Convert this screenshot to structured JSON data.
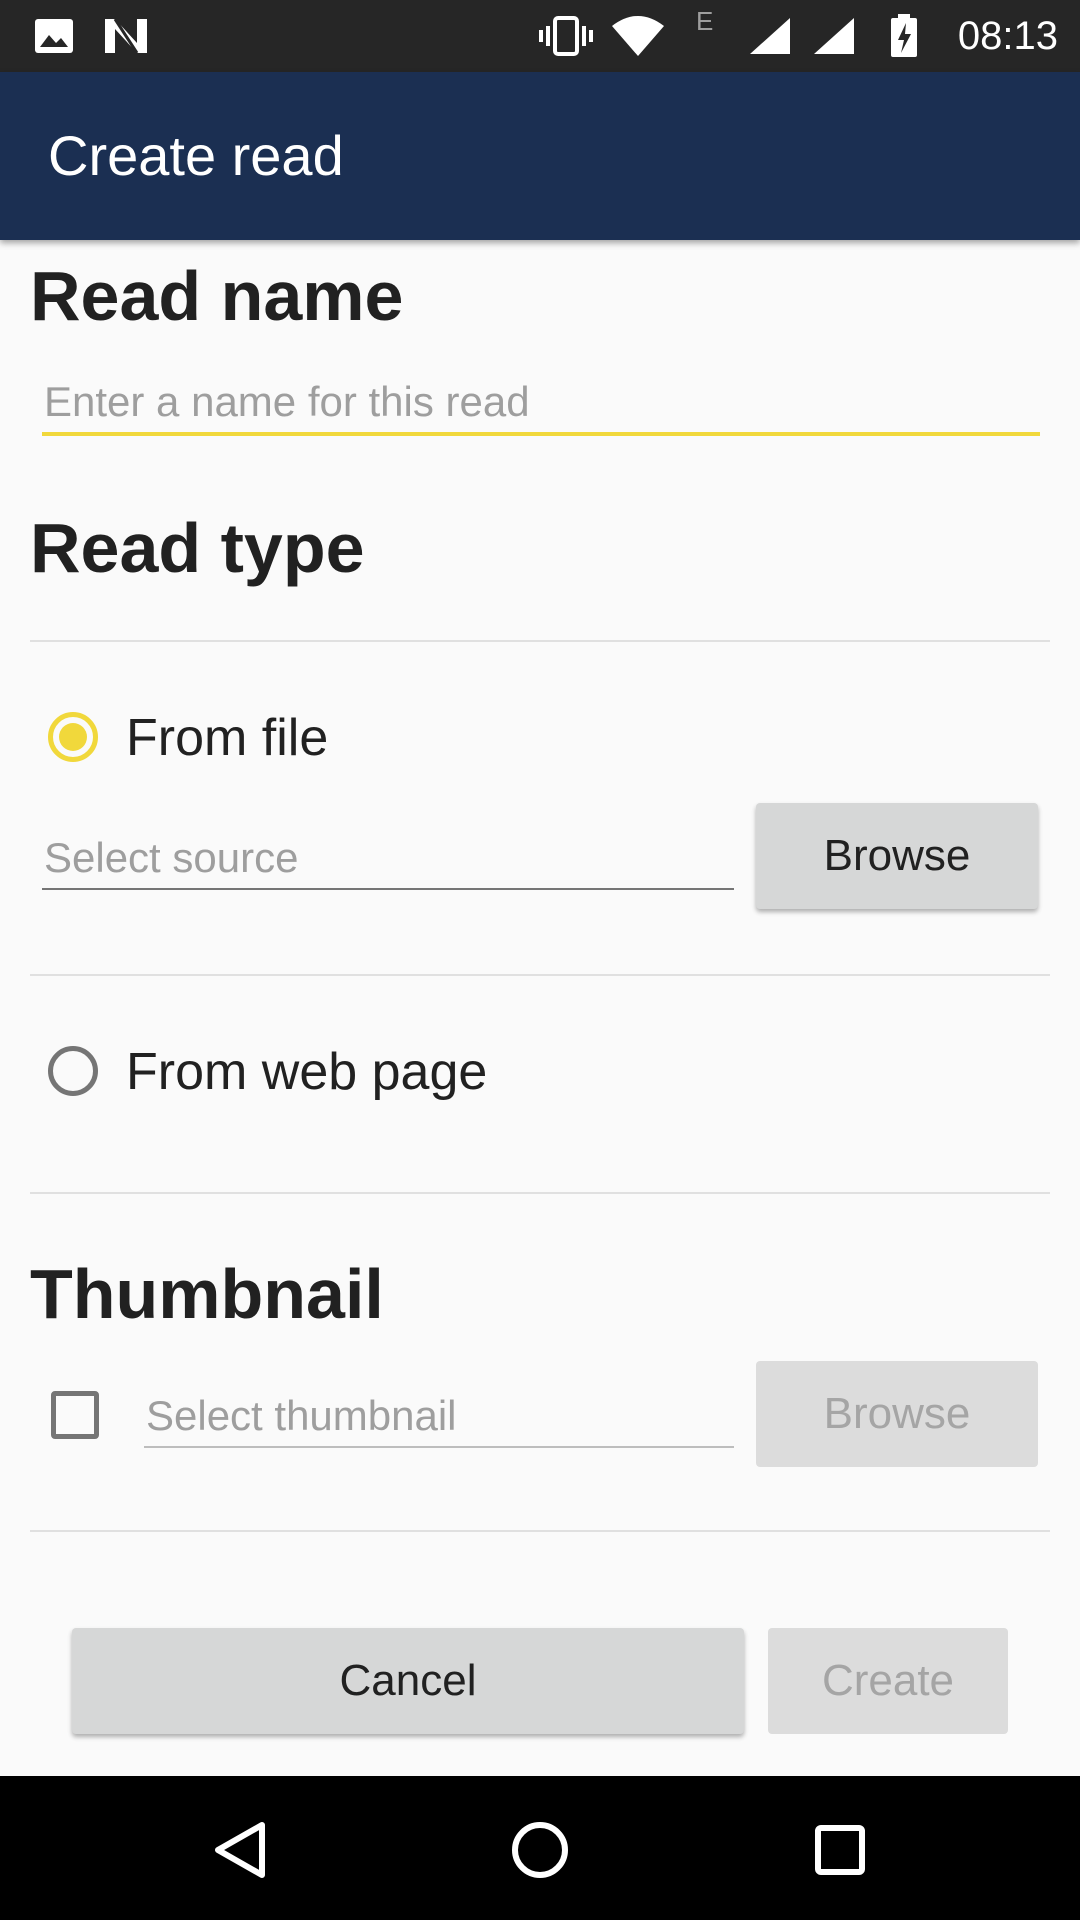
{
  "status_bar": {
    "time": "08:13",
    "network_label": "E",
    "icons": [
      "image-icon",
      "n-icon",
      "vibrate-icon",
      "wifi-icon",
      "signal-icon",
      "signal-icon-2",
      "battery-charging-icon"
    ]
  },
  "app_bar": {
    "title": "Create read"
  },
  "read_name": {
    "heading": "Read name",
    "placeholder": "Enter a name for this read",
    "value": ""
  },
  "read_type": {
    "heading": "Read type",
    "options": [
      {
        "label": "From file",
        "selected": true
      },
      {
        "label": "From web page",
        "selected": false
      }
    ],
    "source_placeholder": "Select source",
    "browse_label": "Browse"
  },
  "thumbnail": {
    "heading": "Thumbnail",
    "checked": false,
    "placeholder": "Select thumbnail",
    "browse_label": "Browse"
  },
  "actions": {
    "cancel_label": "Cancel",
    "create_label": "Create"
  },
  "colors": {
    "app_bar": "#1b2f52",
    "accent": "#f1d83b",
    "status_bar": "#262626"
  },
  "nav_bar": {
    "icons": [
      "back-icon",
      "home-icon",
      "recents-icon"
    ]
  }
}
